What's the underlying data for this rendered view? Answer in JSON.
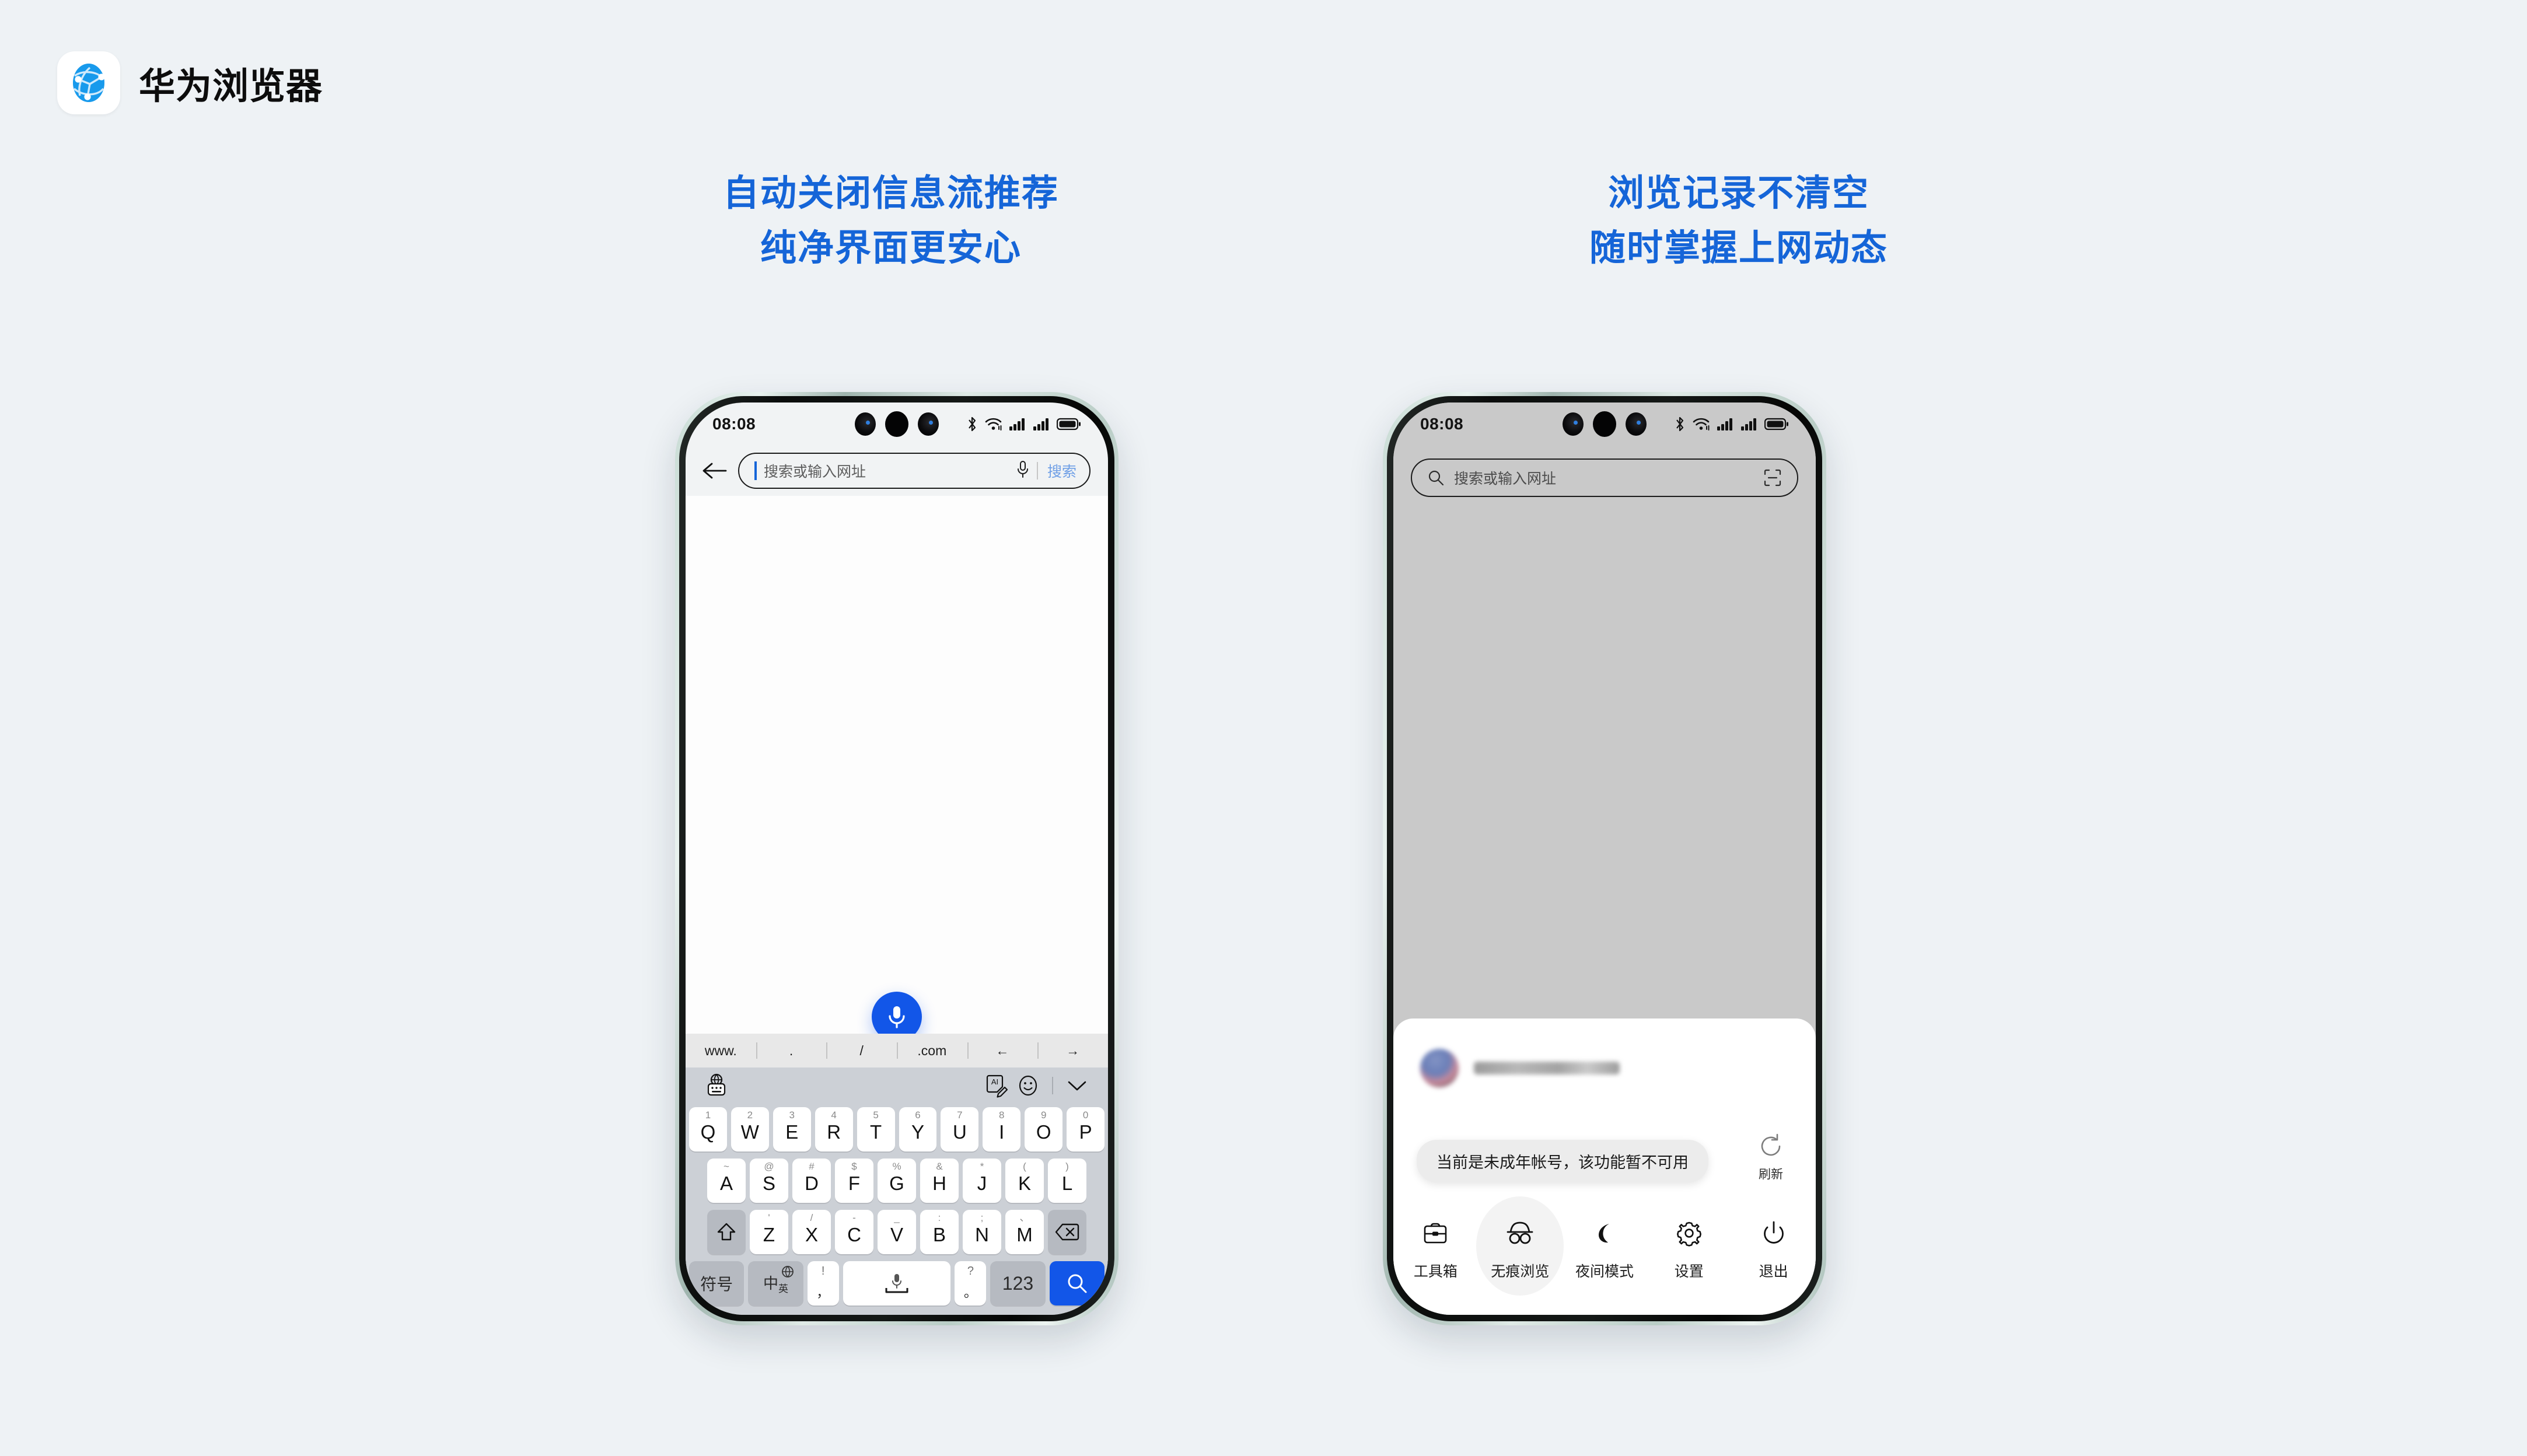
{
  "brand": {
    "name": "华为浏览器",
    "logo_icon": "globe-icon",
    "accent": "#1565d8",
    "background": "#eef2f5"
  },
  "headings": {
    "left": {
      "line1": "自动关闭信息流推荐",
      "line2": "纯净界面更安心"
    },
    "right": {
      "line1": "浏览记录不清空",
      "line2": "随时掌握上网动态"
    }
  },
  "phone_left": {
    "status": {
      "time": "08:08",
      "icons": [
        "bluetooth-icon",
        "wifi-icon",
        "signal-icon",
        "signal-icon",
        "battery-icon"
      ]
    },
    "urlbar": {
      "back_icon": "back-arrow-icon",
      "placeholder": "搜索或输入网址",
      "mic_icon": "microphone-icon",
      "go_label": "搜索"
    },
    "fab": {
      "icon": "microphone-icon",
      "color": "#1256e8"
    },
    "keyboard": {
      "quick": [
        "www.",
        ".",
        "/",
        ".com",
        "←",
        "→"
      ],
      "tools": [
        "globe-keyboard-icon",
        "ai-pen-icon",
        "emoji-icon",
        "chevron-down-icon"
      ],
      "row1": [
        {
          "sup": "1",
          "main": "Q"
        },
        {
          "sup": "2",
          "main": "W"
        },
        {
          "sup": "3",
          "main": "E"
        },
        {
          "sup": "4",
          "main": "R"
        },
        {
          "sup": "5",
          "main": "T"
        },
        {
          "sup": "6",
          "main": "Y"
        },
        {
          "sup": "7",
          "main": "U"
        },
        {
          "sup": "8",
          "main": "I"
        },
        {
          "sup": "9",
          "main": "O"
        },
        {
          "sup": "0",
          "main": "P"
        }
      ],
      "row2": [
        {
          "sup": "~",
          "main": "A"
        },
        {
          "sup": "@",
          "main": "S"
        },
        {
          "sup": "#",
          "main": "D"
        },
        {
          "sup": "$",
          "main": "F"
        },
        {
          "sup": "%",
          "main": "G"
        },
        {
          "sup": "&",
          "main": "H"
        },
        {
          "sup": "*",
          "main": "J"
        },
        {
          "sup": "(",
          "main": "K"
        },
        {
          "sup": ")",
          "main": "L"
        }
      ],
      "row3": [
        {
          "sup": "'",
          "main": "Z"
        },
        {
          "sup": "/",
          "main": "X"
        },
        {
          "sup": "-",
          "main": "C"
        },
        {
          "sup": "_",
          "main": "V"
        },
        {
          "sup": ":",
          "main": "B"
        },
        {
          "sup": ";",
          "main": "N"
        },
        {
          "sup": "、",
          "main": "M"
        }
      ],
      "shift_icon": "shift-icon",
      "backspace_icon": "backspace-icon",
      "row4": {
        "symbols_label": "符号",
        "lang_label": "中",
        "lang_sub": "英",
        "lang_icon": "globe-icon",
        "comma_top": "!",
        "comma_bottom": "，",
        "space_icon": "microphone-icon",
        "period_top": "?",
        "period_bottom": "。",
        "numbers_label": "123",
        "search_icon": "search-icon"
      }
    }
  },
  "phone_right": {
    "status": {
      "time": "08:08",
      "icons": [
        "bluetooth-icon",
        "wifi-icon",
        "signal-icon",
        "signal-icon",
        "battery-icon"
      ]
    },
    "urlbar": {
      "search_icon": "search-icon",
      "placeholder": "搜索或输入网址",
      "scan_icon": "scan-icon"
    },
    "sheet": {
      "avatar": "avatar",
      "username_masked": "",
      "refresh_label": "刷新",
      "refresh_icon": "refresh-icon",
      "toast": "当前是未成年帐号，该功能暂不可用",
      "menu": [
        {
          "label": "工具箱",
          "icon": "toolbox-icon",
          "highlighted": false
        },
        {
          "label": "无痕浏览",
          "icon": "incognito-icon",
          "highlighted": true
        },
        {
          "label": "夜间模式",
          "icon": "moon-icon",
          "highlighted": false
        },
        {
          "label": "设置",
          "icon": "gear-icon",
          "highlighted": false
        },
        {
          "label": "退出",
          "icon": "power-icon",
          "highlighted": false
        }
      ]
    }
  }
}
